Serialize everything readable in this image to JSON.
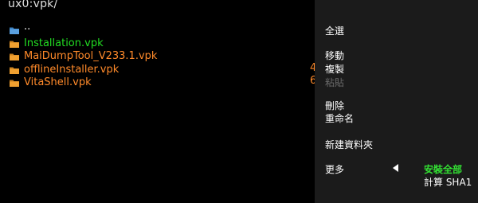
{
  "path": "ux0:vpk/",
  "files": [
    {
      "name": "..",
      "type": "folder",
      "style": "parent"
    },
    {
      "name": "Installation.vpk",
      "type": "file",
      "style": "green"
    },
    {
      "name": "MaiDumpTool_V233.1.vpk",
      "type": "file",
      "style": "orange"
    },
    {
      "name": "offlineInstaller.vpk",
      "type": "file",
      "style": "orange"
    },
    {
      "name": "VitaShell.vpk",
      "type": "file",
      "style": "orange"
    }
  ],
  "size_peek": [
    "4",
    "6"
  ],
  "context_menu": {
    "items": {
      "select_all": "全選",
      "move": "移動",
      "copy": "複製",
      "paste": "粘貼",
      "delete": "刪除",
      "rename": "重命名",
      "new_folder": "新建資料夾",
      "more": "更多"
    },
    "submenu": {
      "install_all": "安裝全部",
      "calc_sha1": "計算 SHA1"
    }
  },
  "colors": {
    "background": "#000000",
    "menu_background": "#1b1b1b",
    "folder_icon": "#3b82c4",
    "file_icon": "#f0a030",
    "selected_file": "#22dd22",
    "vpk_file": "#ff8a2a",
    "active_submenu": "#33e033"
  }
}
